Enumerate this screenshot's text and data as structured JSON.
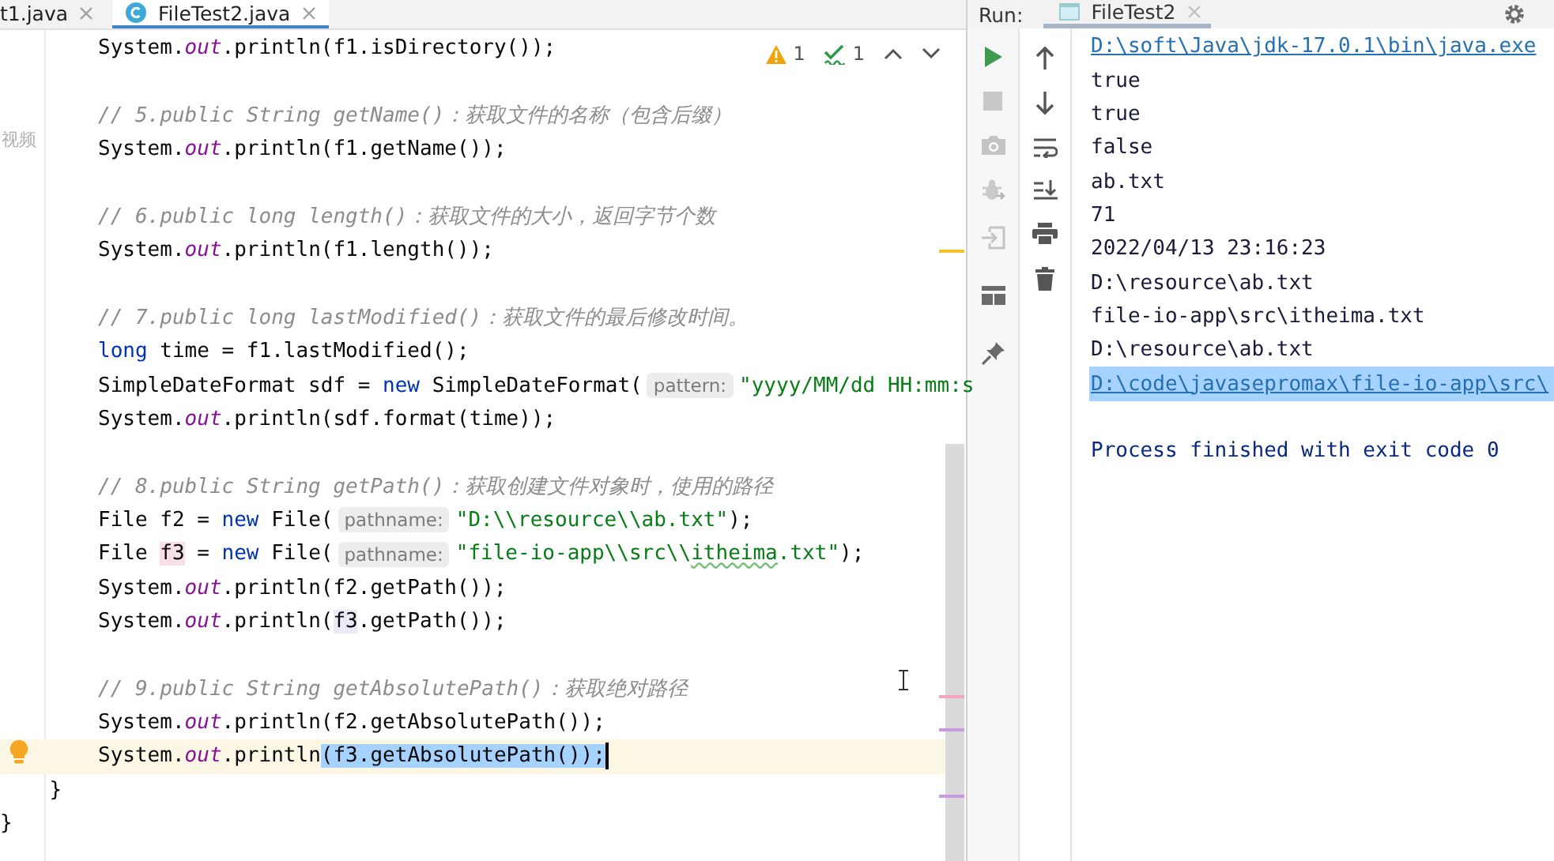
{
  "editor": {
    "tabs": [
      {
        "label": "t1.java",
        "selected": false,
        "kind": "plain"
      },
      {
        "label": "FileTest2.java",
        "selected": true,
        "kind": "class"
      }
    ],
    "side_text": "视频",
    "inspections": [
      {
        "kind": "warning",
        "count": "1"
      },
      {
        "kind": "typo",
        "count": "1"
      }
    ],
    "method_body": [
      {
        "current": false,
        "segments": [
          {
            "kind": "plain",
            "text": "System."
          },
          {
            "kind": "field",
            "text": "out"
          },
          {
            "kind": "plain",
            "text": ".println(f1.isDirectory());"
          }
        ]
      },
      {
        "current": false
      },
      {
        "current": false,
        "segments": [
          {
            "kind": "comment",
            "text": "// 5.public String getName()：获取文件的名称（包含后缀）"
          }
        ]
      },
      {
        "current": false,
        "segments": [
          {
            "kind": "plain",
            "text": "System."
          },
          {
            "kind": "field",
            "text": "out"
          },
          {
            "kind": "plain",
            "text": ".println(f1.getName());"
          }
        ]
      },
      {
        "current": false
      },
      {
        "current": false,
        "segments": [
          {
            "kind": "comment",
            "text": "// 6.public long length()：获取文件的大小，返回字节个数"
          }
        ]
      },
      {
        "current": false,
        "segments": [
          {
            "kind": "plain",
            "text": "System."
          },
          {
            "kind": "field",
            "text": "out"
          },
          {
            "kind": "plain",
            "text": ".println(f1.length());"
          }
        ]
      },
      {
        "current": false
      },
      {
        "current": false,
        "segments": [
          {
            "kind": "comment",
            "text": "// 7.public long lastModified()：获取文件的最后修改时间。"
          }
        ]
      },
      {
        "current": false,
        "segments": [
          {
            "kind": "keyword",
            "text": "long"
          },
          {
            "kind": "plain",
            "text": " time = f1.lastModified();"
          }
        ]
      },
      {
        "current": false,
        "segments": [
          {
            "kind": "plain",
            "text": "SimpleDateFormat sdf = "
          },
          {
            "kind": "keyword",
            "text": "new"
          },
          {
            "kind": "plain",
            "text": " SimpleDateFormat("
          },
          {
            "kind": "hint",
            "text": "pattern:"
          },
          {
            "kind": "string",
            "text": "\"yyyy/MM/dd HH:mm:s"
          }
        ]
      },
      {
        "current": false,
        "segments": [
          {
            "kind": "plain",
            "text": "System."
          },
          {
            "kind": "field",
            "text": "out"
          },
          {
            "kind": "plain",
            "text": ".println(sdf.format(time));"
          }
        ]
      },
      {
        "current": false
      },
      {
        "current": false,
        "segments": [
          {
            "kind": "comment",
            "text": "// 8.public String getPath()：获取创建文件对象时，使用的路径"
          }
        ]
      },
      {
        "current": false,
        "segments": [
          {
            "kind": "plain",
            "text": "File f2 = "
          },
          {
            "kind": "keyword",
            "text": "new"
          },
          {
            "kind": "plain",
            "text": " File("
          },
          {
            "kind": "hint",
            "text": "pathname:"
          },
          {
            "kind": "string",
            "text": "\"D:\\\\resource\\\\ab.txt\""
          },
          {
            "kind": "plain",
            "text": ");"
          }
        ]
      },
      {
        "current": false,
        "segments": [
          {
            "kind": "plain",
            "text": "File "
          },
          {
            "kind": "declmark",
            "text": "f3"
          },
          {
            "kind": "plain",
            "text": " = "
          },
          {
            "kind": "keyword",
            "text": "new"
          },
          {
            "kind": "plain",
            "text": " File("
          },
          {
            "kind": "hint",
            "text": "pathname:"
          },
          {
            "kind": "string",
            "text": "\"file-io-app\\\\src\\\\"
          },
          {
            "kind": "typo",
            "text": "itheima"
          },
          {
            "kind": "string",
            "text": ".txt\""
          },
          {
            "kind": "plain",
            "text": ");"
          }
        ]
      },
      {
        "current": false,
        "segments": [
          {
            "kind": "plain",
            "text": "System."
          },
          {
            "kind": "field",
            "text": "out"
          },
          {
            "kind": "plain",
            "text": ".println(f2.getPath());"
          }
        ]
      },
      {
        "current": false,
        "segments": [
          {
            "kind": "plain",
            "text": "System."
          },
          {
            "kind": "field",
            "text": "out"
          },
          {
            "kind": "plain",
            "text": ".println("
          },
          {
            "kind": "usemark",
            "text": "f3"
          },
          {
            "kind": "plain",
            "text": ".getPath());"
          }
        ]
      },
      {
        "current": false
      },
      {
        "current": false,
        "segments": [
          {
            "kind": "comment",
            "text": "// 9.public String getAbsolutePath()：获取绝对路径"
          }
        ]
      },
      {
        "current": false,
        "segments": [
          {
            "kind": "plain",
            "text": "System."
          },
          {
            "kind": "field",
            "text": "out"
          },
          {
            "kind": "plain",
            "text": ".println(f2.getAbsolutePath());"
          }
        ]
      },
      {
        "current": true,
        "segments": [
          {
            "kind": "plain",
            "text": "System."
          },
          {
            "kind": "field",
            "text": "out"
          },
          {
            "kind": "plain",
            "text": ".println"
          },
          {
            "kind": "selection",
            "text": "(f3.getAbsolutePath());"
          }
        ]
      }
    ],
    "closing_lines": [
      "    }",
      "}"
    ]
  },
  "run": {
    "label": "Run:",
    "tabs": [
      {
        "label": "FileTest2",
        "selected": true
      }
    ],
    "output": [
      {
        "kind": "link",
        "selected": false,
        "text": "D:\\soft\\Java\\jdk-17.0.1\\bin\\java.exe"
      },
      {
        "kind": "text",
        "selected": false,
        "text": "true"
      },
      {
        "kind": "text",
        "selected": false,
        "text": "true"
      },
      {
        "kind": "text",
        "selected": false,
        "text": "false"
      },
      {
        "kind": "text",
        "selected": false,
        "text": "ab.txt"
      },
      {
        "kind": "text",
        "selected": false,
        "text": "71"
      },
      {
        "kind": "text",
        "selected": false,
        "text": "2022/04/13 23:16:23"
      },
      {
        "kind": "text",
        "selected": false,
        "text": "D:\\resource\\ab.txt"
      },
      {
        "kind": "text",
        "selected": false,
        "text": "file-io-app\\src\\itheima.txt"
      },
      {
        "kind": "text",
        "selected": false,
        "text": "D:\\resource\\ab.txt"
      },
      {
        "kind": "link",
        "selected": true,
        "text": "D:\\code\\javasepromax\\file-io-app\\src\\"
      },
      {
        "kind": "blank",
        "selected": false
      },
      {
        "kind": "info",
        "selected": false,
        "text": "Process finished with exit code 0"
      }
    ]
  }
}
